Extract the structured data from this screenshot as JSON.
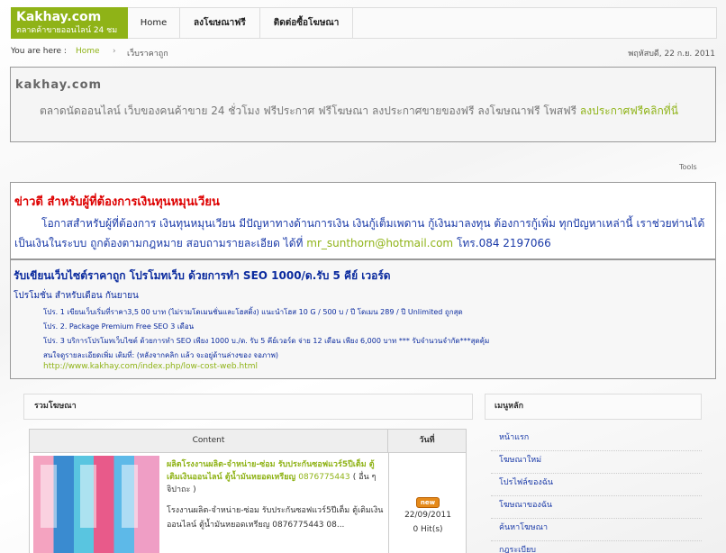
{
  "logo": {
    "title": "Kakhay.com",
    "tagline": "ตลาดค้าขายออนไลน์ 24 ชม"
  },
  "nav": {
    "items": [
      {
        "label": "Home"
      },
      {
        "label": "ลงโฆษณาฟรี"
      },
      {
        "label": "ติดต่อซื้อโฆษณา"
      }
    ]
  },
  "breadcrumb": {
    "label": "You are here :",
    "home": "Home",
    "separator": "›",
    "current": "เว็บราคาถูก",
    "date": "พฤหัสบดี, 22 ก.ย. 2011"
  },
  "intro": {
    "title": "kakhay.com",
    "text": "ตลาดนัดออนไลน์ เว็บของคนค้าขาย 24 ชั่วโมง ฟรีประกาศ ฟรีโฆษณา ลงประกาศขายของฟรี ลงโฆษณาฟรี โพสฟรี",
    "link": "ลงประกาศฟรีคลิกที่นี่"
  },
  "tools": "Tools",
  "news": {
    "title": "ข่าวดี สำหรับผู้ที่ต้องการเงินทุนหมุนเวียน",
    "text": "โอกาสสำหรับผู้ที่ต้องการ เงินทุนหมุนเวียน มีปัญหาทางด้านการเงิน เงินกู้เต็มเพดาน กู้เงินมาลงทุน ต้องการกู้เพิ่ม ทุกปัญหาเหล่านี้ เราช่วยท่านได้ เป็นเงินในระบบ ถูกต้องตามกฎหมาย สอบถามรายละเอียด ได้ที่",
    "email": "mr_sunthorn@hotmail.com",
    "phone": "โทร.084 2197066"
  },
  "seo": {
    "title": "รับเขียนเว็บไซต์ราคาถูก โปรโมทเว็บ ด้วยการทำ SEO 1000/ด.รับ 5 คีย์ เวอร์ด",
    "promo_label": "โปรโมชั่น สำหรับเดือน กันยายน",
    "items": [
      "โปร. 1 เขียนเว็บเริ่มที่ราคา3,5 00 บาท (ไม่รวมโดเมนชั่นและโฮสติ้ง) แนะนำโฮส 10 G / 500 บ / ปี โดเมน 289 / ปี Unlimited ถูกสุด",
      "โปร. 2. Package Premium Free SEO 3 เดือน",
      "โปร. 3 บริการโปรโมทเว็บไซต์ ด้วยการทำ SEO เพียง 1000 บ./ด. รับ 5 คีย์เวอร์ด จ่าย 12 เดือน เพียง 6,000 บาท *** รับจำนวนจำกัด***สุดคุ้ม",
      "สนใจดูรายละเอียดเพิ่ม เติมที่: (หลังจากคลิก แล้ว จะอยู่ด้านล่างของ จอภาพ)"
    ],
    "url": "http://www.kakhay.com/index.php/low-cost-web.html"
  },
  "listing": {
    "header": "รวมโฆษณา",
    "columns": {
      "content": "Content",
      "date": "วันที่"
    },
    "rows": [
      {
        "title": "ผลิตโรงงานผลิต-จำหน่าย-ซ่อม รับประกันซอฟแวร์5ปีเต็ม ตู้เติมเงินออนไลน์ ตู้น้ำมันหยอดเหรียญ",
        "phone": "0876775443",
        "category": "( อื่น ๆ จิปาถะ )",
        "description": "โรงงานผลิต-จำหน่าย-ซ่อม รับประกันซอฟแวร์5ปีเต็ม ตู้เติมเงินออนไลน์ ตู้น้ำมันหยอดเหรียญ 0876775443 08...",
        "badge": "new",
        "date": "22/09/2011",
        "hits": "0 Hit(s)"
      }
    ]
  },
  "sidebar": {
    "header": "เมนูหลัก",
    "items": [
      {
        "label": "หน้าแรก"
      },
      {
        "label": "โฆษณาใหม่"
      },
      {
        "label": "โปรไฟล์ของฉัน"
      },
      {
        "label": "โฆษณาของฉัน"
      },
      {
        "label": "ค้นหาโฆษณา"
      },
      {
        "label": "กฎระเบียบ"
      }
    ]
  },
  "colors": {
    "accent": "#8fb317",
    "link": "#1a3aa8",
    "news_title": "#dd0000"
  }
}
